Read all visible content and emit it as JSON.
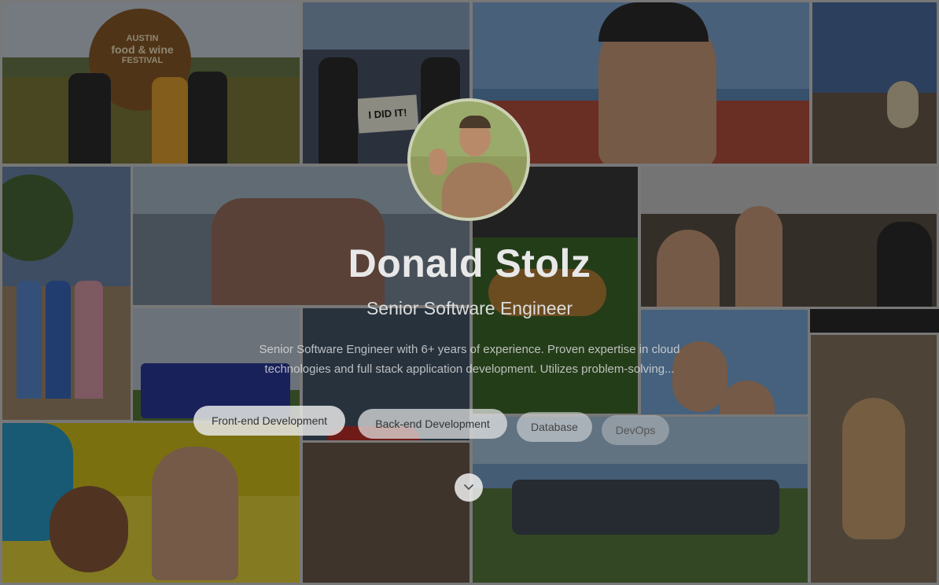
{
  "profile": {
    "name": "Donald Stolz",
    "title": "Senior Software Engineer",
    "summary": "Senior Software Engineer with 6+ years of experience. Proven expertise in cloud technologies and full stack application development. Utilizes problem-solving..."
  },
  "skills": [
    {
      "label": "Front-end Development"
    },
    {
      "label": "Back-end Development"
    },
    {
      "label": "Database"
    },
    {
      "label": "DevOps"
    }
  ],
  "photo_sign_text": "I DID IT!",
  "festival_sign": {
    "line1": "AUSTIN",
    "line2": "food & wine",
    "line3": "FESTIVAL"
  },
  "scroll_icon": "chevron-down-icon",
  "colors": {
    "overlay": "rgba(0,0,0,0.42)",
    "pill_bg": "#e6e6e6",
    "name_text": "#e8e8e8"
  }
}
